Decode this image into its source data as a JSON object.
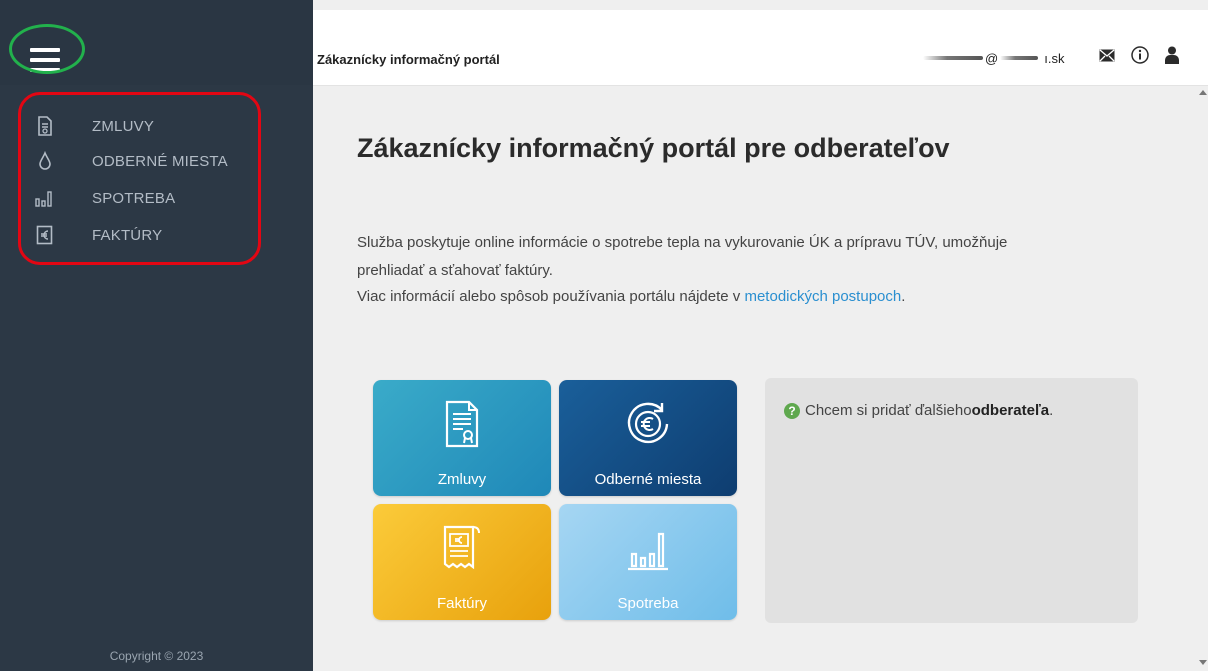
{
  "header": {
    "title": "Zákaznícky informačný portál",
    "user_at": "@",
    "user_domain_suffix": ".sk",
    "user_domain_partial": "ı"
  },
  "sidebar": {
    "items": [
      {
        "label": "ZMLUVY",
        "icon": "document-icon"
      },
      {
        "label": "ODBERNÉ MIESTA",
        "icon": "drop-icon"
      },
      {
        "label": "SPOTREBA",
        "icon": "bar-chart-icon"
      },
      {
        "label": "FAKTÚRY",
        "icon": "euro-icon"
      }
    ],
    "copyright": "Copyright © 2023"
  },
  "main": {
    "title": "Zákaznícky informačný portál pre odberateľov",
    "para1_line1": "Služba poskytuje online informácie o spotrebe tepla na vykurovanie ÚK a prípravu TÚV, umožňuje",
    "para1_line2": "prehliadať a sťahovať faktúry.",
    "para2_prefix": "Viac informácií alebo spôsob používania portálu nájdete v ",
    "para2_link": "metodických postupoch",
    "para2_suffix": ".",
    "tiles": [
      {
        "label": "Zmluvy",
        "icon": "contract-icon",
        "color": "#2a9bc2"
      },
      {
        "label": "Odberné miesta",
        "icon": "euro-refresh-icon",
        "color": "#124d86"
      },
      {
        "label": "Faktúry",
        "icon": "invoice-icon",
        "color": "#f3b522"
      },
      {
        "label": "Spotreba",
        "icon": "bar-chart-icon",
        "color": "#8ccbef"
      }
    ],
    "info": {
      "prefix": "Chcem si pridať ďalšieho ",
      "bold": "odberateľa",
      "suffix": "."
    }
  },
  "colors": {
    "sidebar_bg": "#2c3845",
    "link": "#2a8fd0",
    "highlight_green": "#22b14c",
    "highlight_red": "#e30613"
  }
}
